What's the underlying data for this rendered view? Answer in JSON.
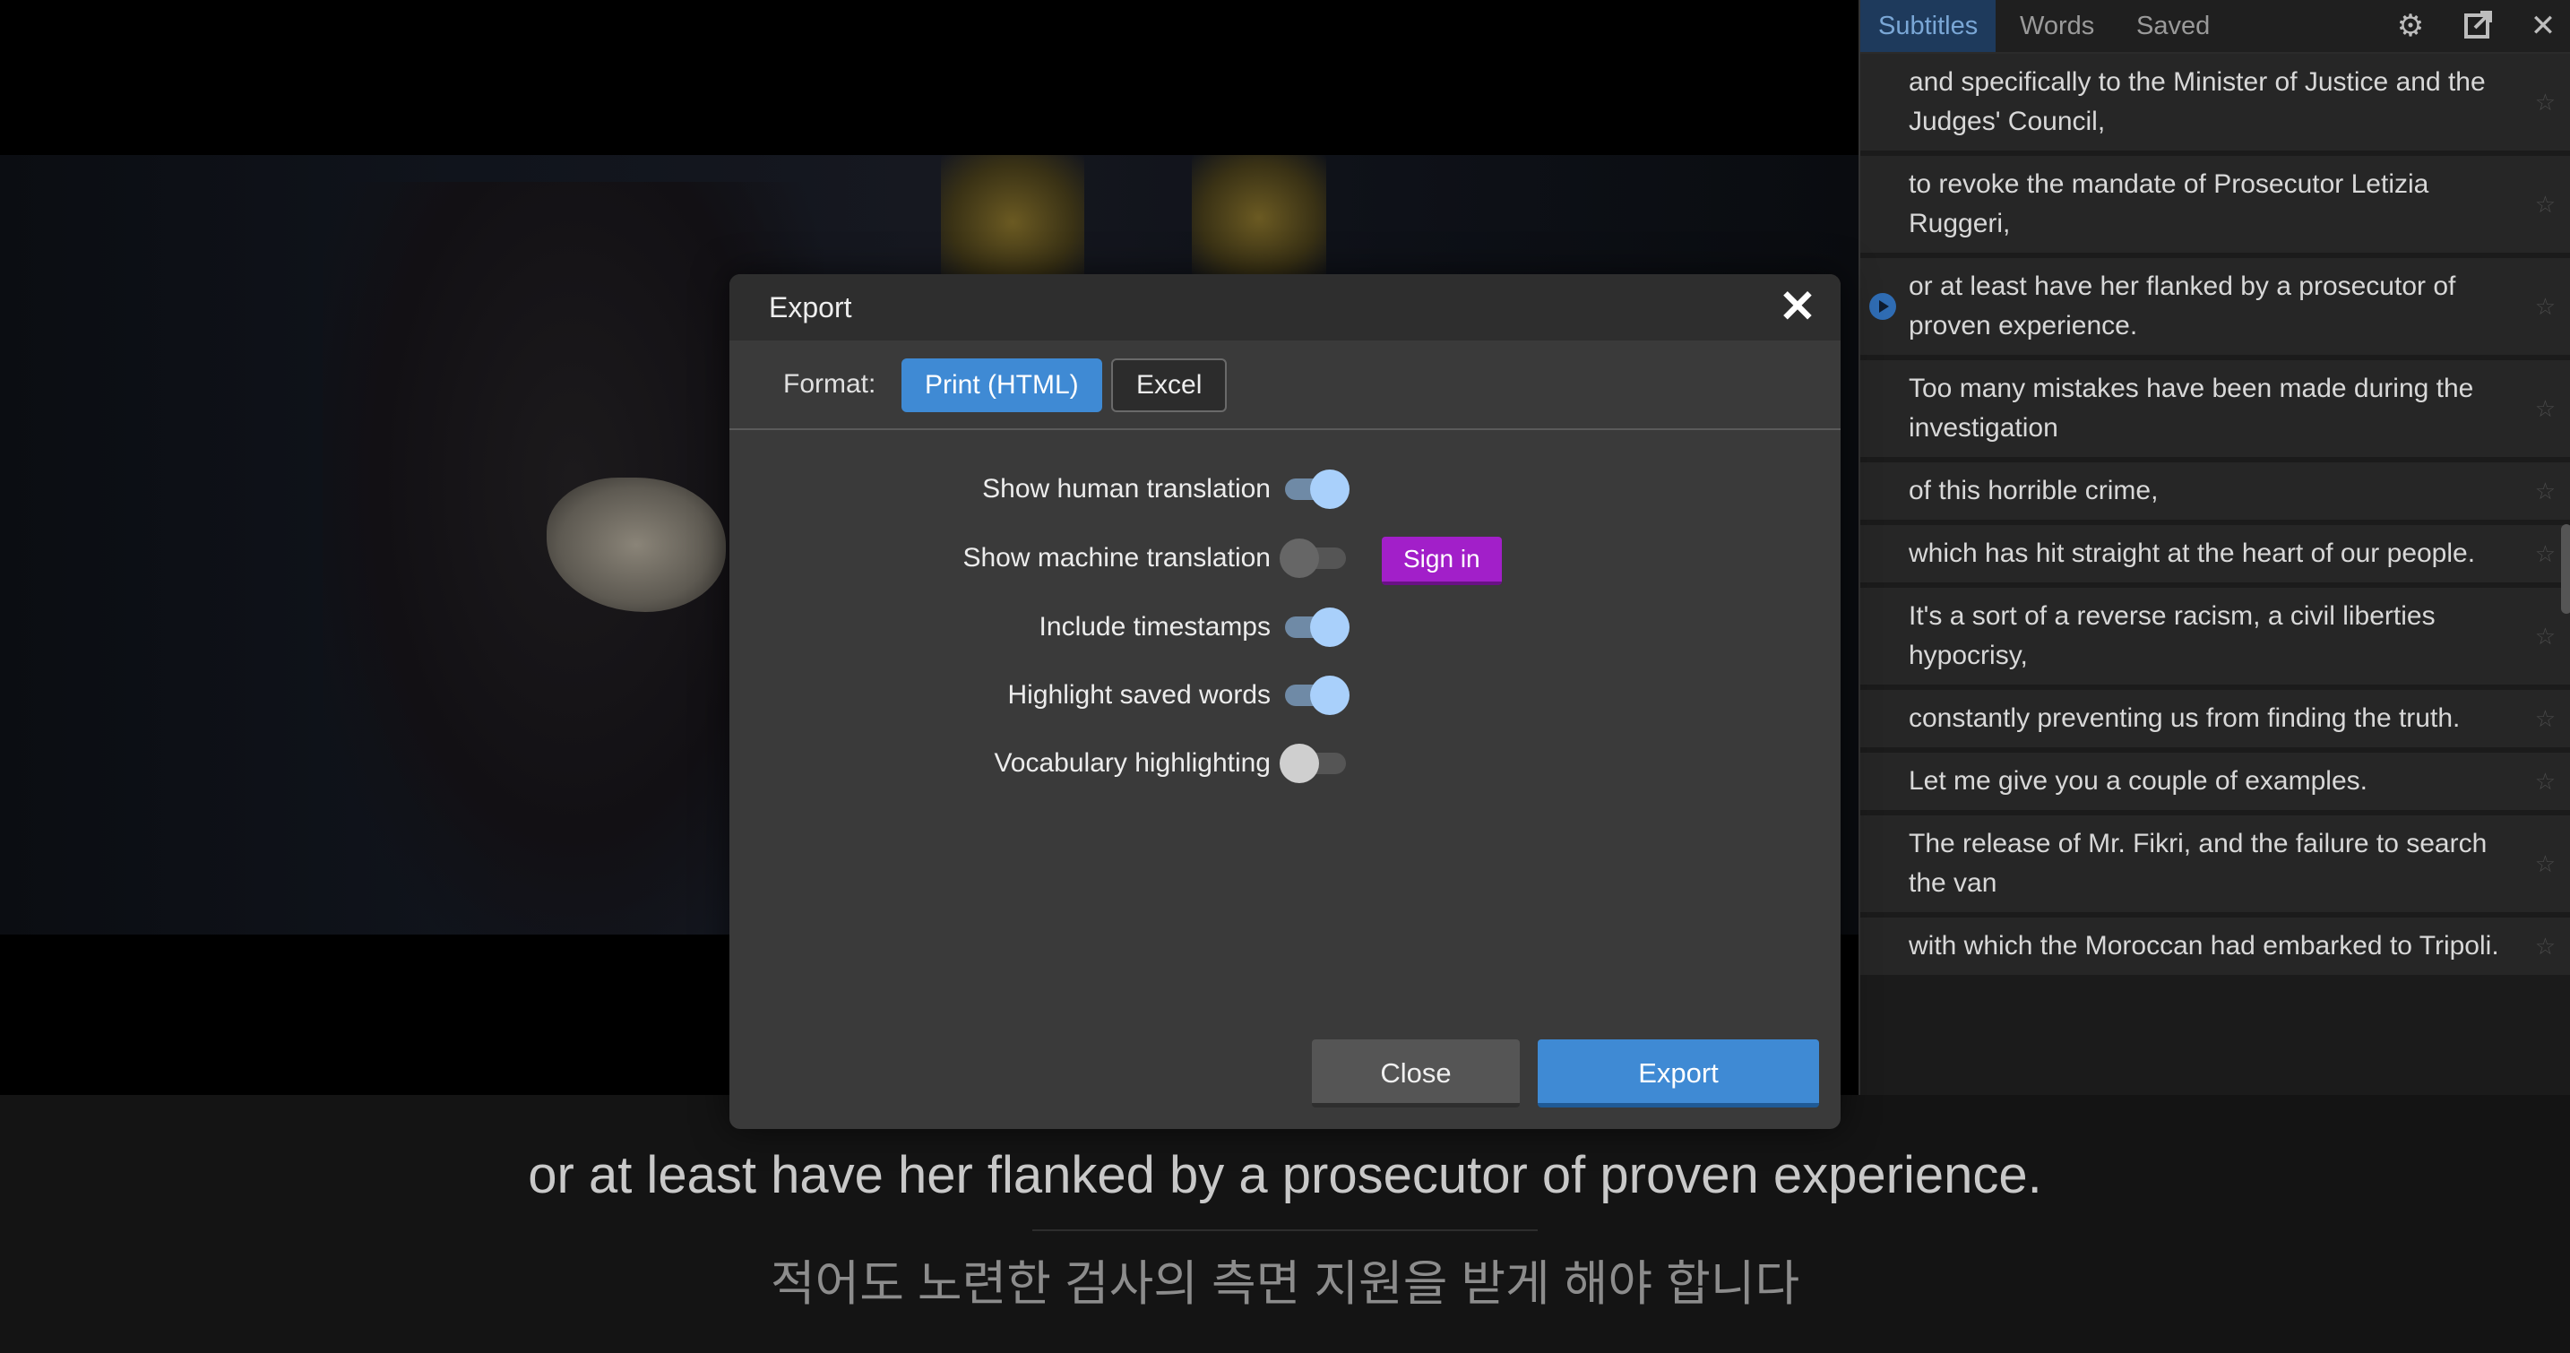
{
  "colors": {
    "accent": "#3f8ad4",
    "signin": "#a21fc9",
    "toggle_on": "#a9d0fb"
  },
  "sidebar": {
    "tabs": [
      {
        "label": "Subtitles",
        "active": true
      },
      {
        "label": "Words",
        "active": false
      },
      {
        "label": "Saved",
        "active": false
      }
    ],
    "icons": [
      "gear-icon",
      "export-icon",
      "close-icon"
    ],
    "items": [
      {
        "text": "and specifically to the Minister of Justice and the Judges' Council,"
      },
      {
        "text": "to revoke the mandate of Prosecutor Letizia Ruggeri,"
      },
      {
        "text": "or at least have her flanked by a prosecutor of proven experience.",
        "playing": true
      },
      {
        "text": "Too many mistakes have been made during the investigation"
      },
      {
        "text": "of this horrible crime,"
      },
      {
        "text": "which has hit straight at the heart of our people."
      },
      {
        "text": "It's a sort of a reverse racism, a civil liberties hypocrisy,"
      },
      {
        "text": "constantly preventing us from finding the truth."
      },
      {
        "text": "Let me give you a couple of examples."
      },
      {
        "text": "The release of Mr. Fikri, and the failure to search the van"
      },
      {
        "text": "with which the Moroccan had embarked to Tripoli."
      }
    ]
  },
  "modal": {
    "title": "Export",
    "format_label": "Format:",
    "formats": [
      {
        "label": "Print (HTML)",
        "selected": true
      },
      {
        "label": "Excel",
        "selected": false
      }
    ],
    "options": [
      {
        "label": "Show human translation",
        "on": true
      },
      {
        "label": "Show machine translation",
        "on": false,
        "signin": "Sign in"
      },
      {
        "label": "Include timestamps",
        "on": true
      },
      {
        "label": "Highlight saved words",
        "on": true
      },
      {
        "label": "Vocabulary highlighting",
        "on": false
      }
    ],
    "close_label": "Close",
    "export_label": "Export"
  },
  "subtitles": {
    "primary": "or at least have her flanked by a prosecutor of proven experience.",
    "translation": "적어도 노련한 검사의 측면 지원을 받게 해야 합니다"
  }
}
